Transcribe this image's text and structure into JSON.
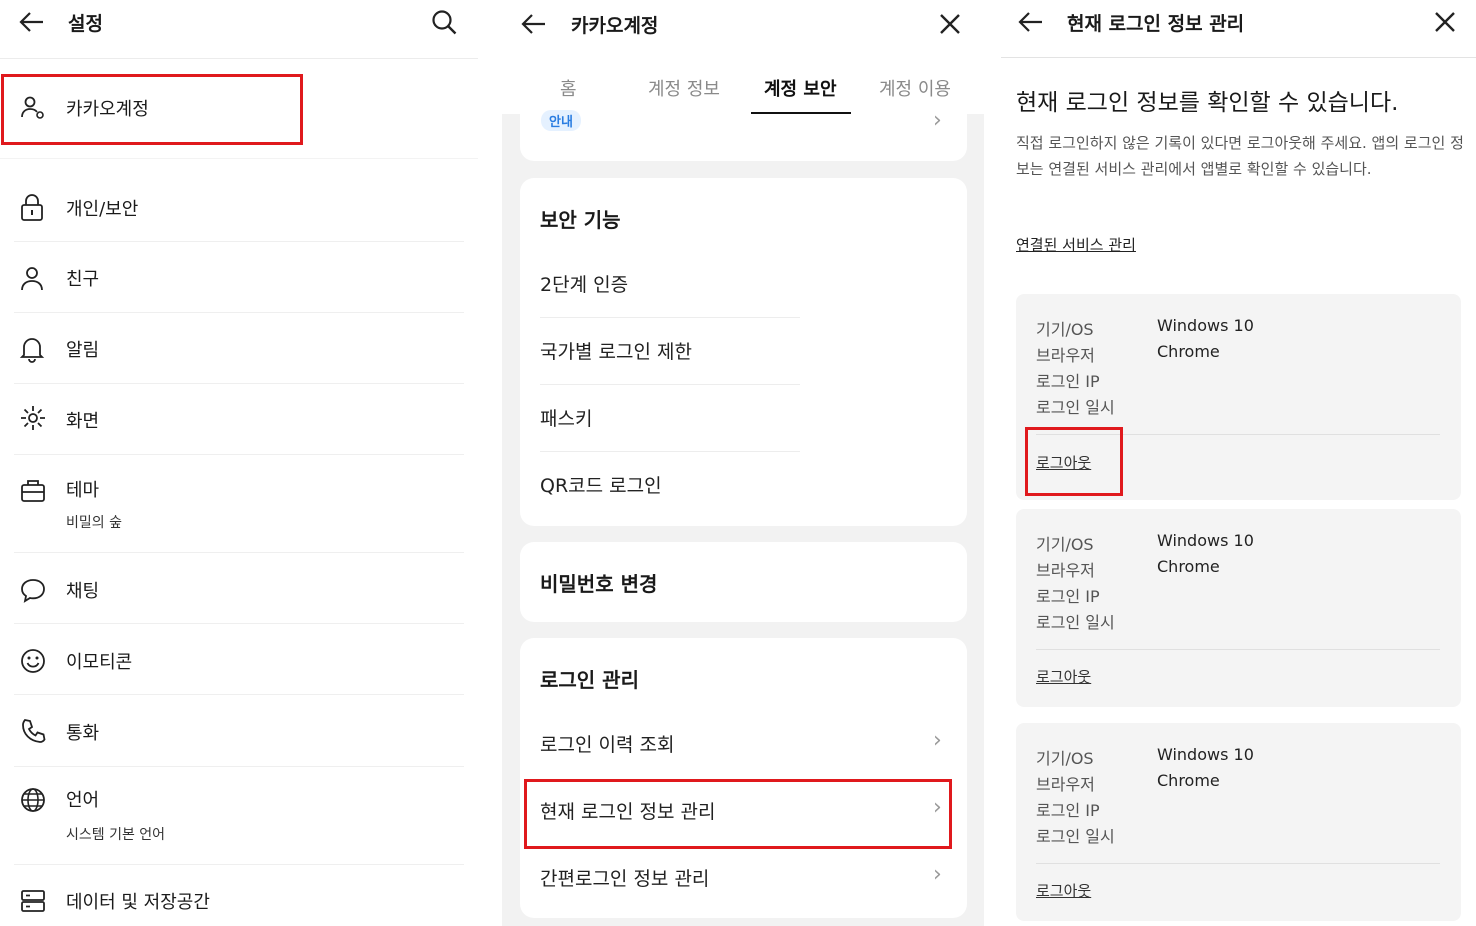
{
  "settings": {
    "title": "설정",
    "items": [
      {
        "label": "카카오계정",
        "icon": "account-icon"
      },
      {
        "label": "개인/보안",
        "icon": "lock-icon"
      },
      {
        "label": "친구",
        "icon": "person-icon"
      },
      {
        "label": "알림",
        "icon": "bell-icon"
      },
      {
        "label": "화면",
        "icon": "display-icon"
      },
      {
        "label": "테마",
        "sub": "비밀의 숲",
        "icon": "theme-icon"
      },
      {
        "label": "채팅",
        "icon": "chat-icon"
      },
      {
        "label": "이모티콘",
        "icon": "emoticon-icon"
      },
      {
        "label": "통화",
        "icon": "phone-icon"
      },
      {
        "label": "언어",
        "sub": "시스템 기본 언어",
        "icon": "globe-icon"
      },
      {
        "label": "데이터 및 저장공간",
        "icon": "storage-icon"
      }
    ]
  },
  "account": {
    "title": "카카오계정",
    "tabs": [
      "홈",
      "계정 정보",
      "계정 보안",
      "계정 이용"
    ],
    "active_tab": "계정 보안",
    "notice_badge": "안내",
    "security_features": {
      "title": "보안 기능",
      "items": [
        "2단계 인증",
        "국가별 로그인 제한",
        "패스키",
        "QR코드 로그인"
      ]
    },
    "password_change": "비밀번호 변경",
    "login_management": {
      "title": "로그인 관리",
      "items": [
        "로그인 이력 조회",
        "현재 로그인 정보 관리",
        "간편로그인 정보 관리"
      ]
    }
  },
  "current_login": {
    "title": "현재 로그인 정보 관리",
    "heading": "현재 로그인 정보를 확인할 수 있습니다.",
    "description": "직접 로그인하지 않은 기록이 있다면 로그아웃해 주세요. 앱의 로그인 정보는 연결된 서비스 관리에서 앱별로 확인할 수 있습니다.",
    "link": "연결된 서비스 관리",
    "labels": {
      "device": "기기/OS",
      "browser": "브라우저",
      "ip": "로그인 IP",
      "time": "로그인 일시"
    },
    "logout_label": "로그아웃",
    "sessions": [
      {
        "device": "Windows 10",
        "browser": "Chrome"
      },
      {
        "device": "Windows 10",
        "browser": "Chrome"
      },
      {
        "device": "Windows 10",
        "browser": "Chrome"
      }
    ]
  },
  "highlight_color": "#e0191d"
}
